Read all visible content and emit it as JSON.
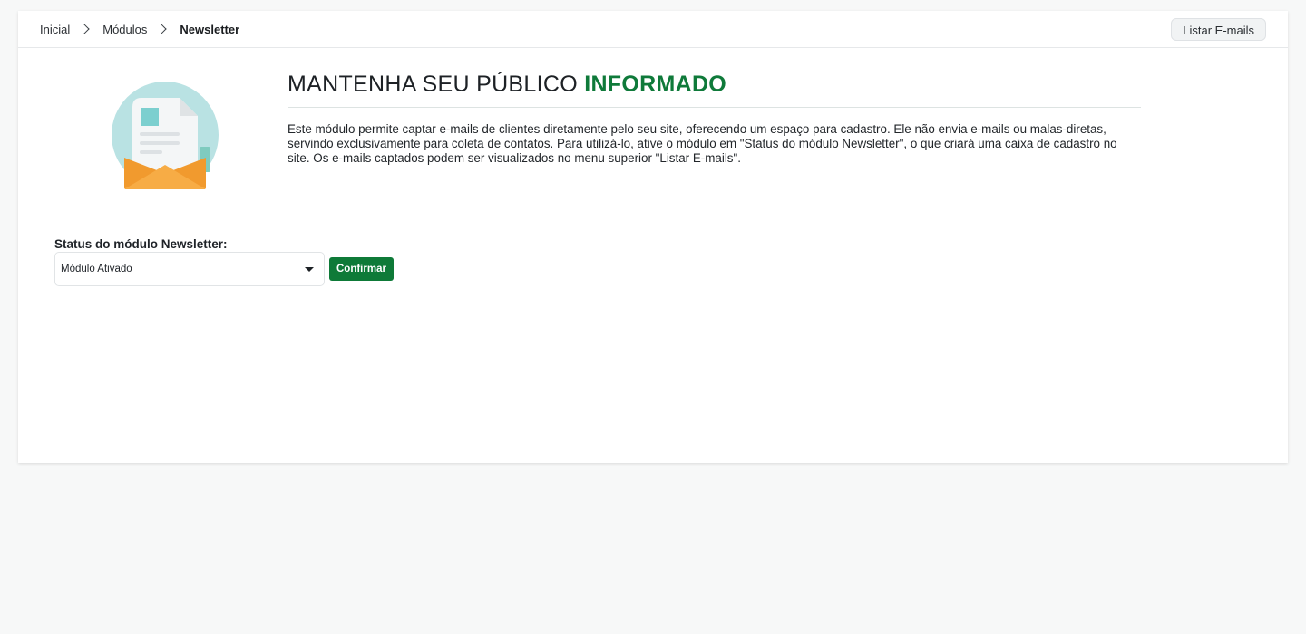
{
  "breadcrumb": {
    "items": [
      "Inicial",
      "Módulos",
      "Newsletter"
    ]
  },
  "header": {
    "list_button_label": "Listar E-mails"
  },
  "intro": {
    "headline_main": "MANTENHA SEU PÚBLICO ",
    "headline_accent": "INFORMADO",
    "description": "Este módulo permite captar e-mails de clientes diretamente pelo seu site, oferecendo um espaço para cadastro. Ele não envia e-mails ou malas-diretas, servindo exclusivamente para coleta de contatos. Para utilizá-lo, ative o módulo em \"Status do módulo Newsletter\", o que criará uma caixa de cadastro no site. Os e-mails captados podem ser visualizados no menu superior \"Listar E-mails\"."
  },
  "form": {
    "status_label": "Status do módulo Newsletter:",
    "status_selected": "Módulo Ativado",
    "confirm_label": "Confirmar"
  },
  "colors": {
    "accent_green": "#0f7a3a",
    "envelope_orange": "#f6a43a",
    "circle_teal": "#b9e2e3"
  },
  "icons": {
    "illustration": "newsletter-envelope-icon",
    "breadcrumb_separator": "chevron-right-icon",
    "select_caret": "caret-down-icon"
  }
}
